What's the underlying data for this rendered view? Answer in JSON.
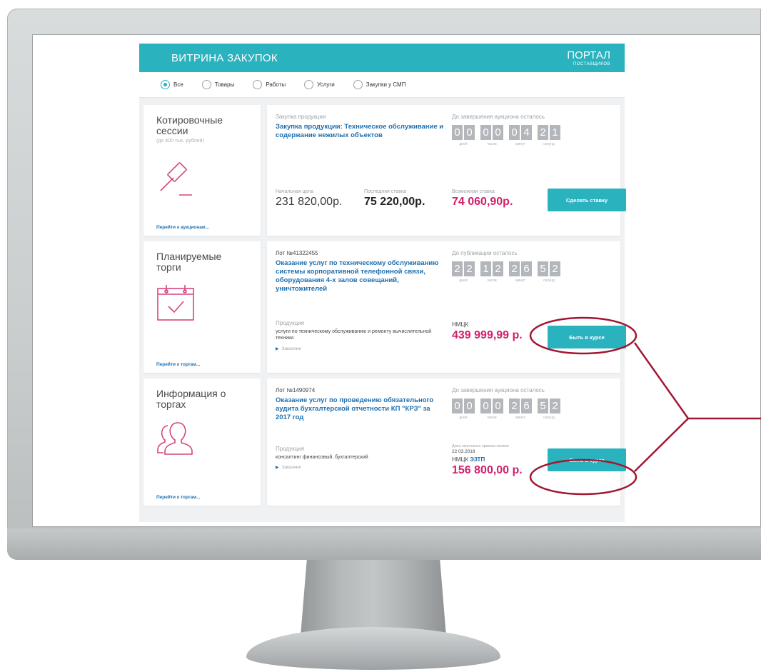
{
  "header": {
    "title": "ВИТРИНА ЗАКУПОК",
    "portal_title": "ПОРТАЛ",
    "portal_sub": "ПОСТАВЩИКОВ"
  },
  "filters": [
    {
      "label": "Все",
      "selected": true
    },
    {
      "label": "Товары",
      "selected": false
    },
    {
      "label": "Работы",
      "selected": false
    },
    {
      "label": "Услуги",
      "selected": false
    },
    {
      "label": "Закупки у СМП",
      "selected": false
    }
  ],
  "sections": [
    {
      "left_title": "Котировочные сессии",
      "left_sub": "(до 400 тыс. рублей)",
      "left_icon": "gavel-icon",
      "left_link": "Перейти к аукционам...",
      "lot_label": "Закупка продукции",
      "lot_title": "Закупка продукции: Техническое обслуживание и содержание нежилых объектов",
      "timer_label": "До завершения аукциона осталось",
      "digits": [
        "0",
        "0",
        "0",
        "0",
        "0",
        "4",
        "2",
        "1"
      ],
      "units": [
        "дней",
        "часов",
        "минут",
        "секунд"
      ],
      "start_price_label": "Начальная цена",
      "start_price": "231 820,00р.",
      "last_bid_label": "Последняя ставка",
      "last_bid": "75 220,00р.",
      "possible_bid_label": "Возможная ставка",
      "possible_bid": "74 060,90р.",
      "button": "Сделать ставку"
    },
    {
      "left_title": "Планируемые торги",
      "left_icon": "calendar-check-icon",
      "left_link": "Перейти к торгам...",
      "lot_label": "Лот №41322455",
      "lot_title": "Оказание услуг по техническому обслуживанию системы корпоративной телефонной связи, оборудования 4-х залов совещаний, уничтожителей",
      "timer_label": "До публикации осталось",
      "digits": [
        "2",
        "2",
        "1",
        "2",
        "2",
        "6",
        "5",
        "2"
      ],
      "units": [
        "дней",
        "часов",
        "минут",
        "секунд"
      ],
      "product_label": "Продукция",
      "product": "услуги по техническому обслуживанию и ремонту вычислительной техники",
      "customer": "Заказчик",
      "nmck_label": "НМЦК",
      "nmck": "439 999,99 р.",
      "button": "Быть в курсе"
    },
    {
      "left_title": "Информация о торгах",
      "left_icon": "users-icon",
      "left_link": "Перейти к торгам...",
      "lot_label": "Лот №1490974",
      "lot_title": "Оказание услуг по проведению обязательного аудита бухгалтерской отчетности КП \"КРЗ\" за 2017 год",
      "timer_label": "До завершения аукциона осталось",
      "digits": [
        "0",
        "0",
        "0",
        "0",
        "2",
        "6",
        "5",
        "2"
      ],
      "units": [
        "дней",
        "часов",
        "минут",
        "секунд"
      ],
      "product_label": "Продукция",
      "product": "консалтинг финансовый, бухгалтерский",
      "customer": "Заказчик",
      "deadline_label": "Дата окончания приема заявок:",
      "deadline": "22.03.2018",
      "nmck_label": "НМЦК",
      "nmck_suffix": "ЭЗТП",
      "nmck": "156 800,00 р.",
      "button": "Быть в курсе"
    }
  ],
  "colors": {
    "accent": "#2bb2bf",
    "link": "#1c6fb0",
    "price_pink": "#d11f6b",
    "icon_pink": "#d6457f",
    "annotation": "#a01830"
  }
}
